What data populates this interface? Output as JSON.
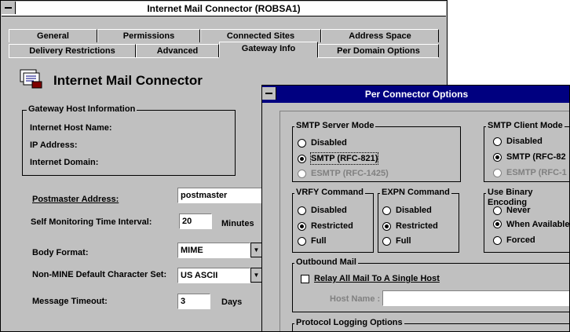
{
  "main_window": {
    "title": "Internet Mail Connector (ROBSA1)",
    "tabs_row1": [
      "General",
      "Permissions",
      "Connected Sites",
      "Address Space"
    ],
    "tabs_row2": [
      "Delivery Restrictions",
      "Advanced",
      "Gateway Info",
      "Per Domain Options"
    ],
    "active_tab": "Gateway Info",
    "header_icon": "mail-connector-icon",
    "heading": "Internet Mail Connector",
    "gateway_group": {
      "title": "Gateway Host Information",
      "host_name_label": "Internet Host Name:",
      "ip_label": "IP Address:",
      "domain_label": "Internet Domain:"
    },
    "postmaster_label": "Postmaster Address:",
    "postmaster_value": "postmaster",
    "monitor_label": "Self Monitoring Time Interval:",
    "monitor_value": "20",
    "monitor_unit": "Minutes",
    "body_format_label": "Body Format:",
    "body_format_value": "MIME",
    "charset_label": "Non-MINE Default Character Set:",
    "charset_value": "US ASCII",
    "timeout_label": "Message Timeout:",
    "timeout_value": "3",
    "timeout_unit": "Days"
  },
  "dialog": {
    "title": "Per Connector Options",
    "smtp_server": {
      "title": "SMTP Server Mode",
      "options": [
        "Disabled",
        "SMTP (RFC-821)",
        "ESMTP (RFC-1425)"
      ],
      "selected": "SMTP (RFC-821)"
    },
    "smtp_client": {
      "title": "SMTP Client Mode",
      "options": [
        "Disabled",
        "SMTP (RFC-82",
        "ESMTP (RFC-1"
      ],
      "selected": "SMTP (RFC-82"
    },
    "vrfy": {
      "title": "VRFY Command",
      "options": [
        "Disabled",
        "Restricted",
        "Full"
      ],
      "selected": "Restricted"
    },
    "expn": {
      "title": "EXPN Command",
      "options": [
        "Disabled",
        "Restricted",
        "Full"
      ],
      "selected": "Restricted"
    },
    "binary": {
      "title": "Use Binary Encoding",
      "options": [
        "Never",
        "When Available",
        "Forced"
      ],
      "selected": "When Available"
    },
    "outbound": {
      "title": "Outbound Mail",
      "relay_label": "Relay All Mail To A Single Host",
      "host_name_label": "Host Name :"
    },
    "logging_title": "Protocol Logging Options"
  }
}
